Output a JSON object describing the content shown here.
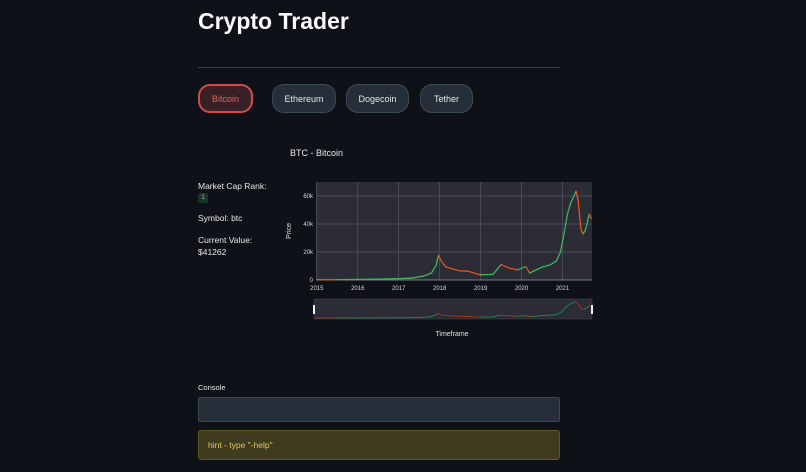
{
  "app": {
    "title": "Crypto Trader"
  },
  "coins": [
    {
      "label": "Bitcoin",
      "active": true
    },
    {
      "label": "Ethereum",
      "active": false
    },
    {
      "label": "Dogecoin",
      "active": false
    },
    {
      "label": "Tether",
      "active": false
    }
  ],
  "info": {
    "rank_label": "Market Cap Rank:",
    "rank_value": "1",
    "symbol": "Symbol: btc",
    "value_label": "Current Value:",
    "value": "$41262"
  },
  "chart_data": {
    "type": "line",
    "title": "BTC - Bitcoin",
    "xlabel": "Timeframe",
    "ylabel": "Price",
    "x_ticks": [
      "2015",
      "2016",
      "2017",
      "2018",
      "2019",
      "2020",
      "2021"
    ],
    "y_ticks": [
      "0",
      "20k",
      "40k",
      "60k"
    ],
    "ylim": [
      0,
      70000
    ],
    "xlim": [
      2014.98,
      2021.72
    ],
    "grid": true,
    "range_slider": true,
    "colors": {
      "up": "#3db65a",
      "down": "#e8501e"
    },
    "series": [
      {
        "x": [
          2015.0,
          2015.5,
          2016.0,
          2016.5,
          2017.0,
          2017.3,
          2017.6,
          2017.8,
          2017.92,
          2017.97,
          2018.05,
          2018.15,
          2018.3,
          2018.5,
          2018.7,
          2018.85,
          2019.0,
          2019.3,
          2019.5,
          2019.7,
          2019.9,
          2020.1,
          2020.2,
          2020.5,
          2020.7,
          2020.85,
          2020.95,
          2021.05,
          2021.12,
          2021.2,
          2021.28,
          2021.33,
          2021.38,
          2021.45,
          2021.5,
          2021.55,
          2021.6,
          2021.65,
          2021.7
        ],
        "y": [
          300,
          250,
          430,
          650,
          1000,
          1300,
          2800,
          5000,
          11000,
          17500,
          13000,
          9500,
          8000,
          6500,
          6300,
          4800,
          3700,
          4000,
          11000,
          8500,
          7200,
          9500,
          5000,
          9200,
          10800,
          13500,
          20000,
          35000,
          47000,
          55000,
          60000,
          63500,
          57000,
          36000,
          33000,
          35000,
          40000,
          47000,
          44000
        ]
      }
    ]
  },
  "console": {
    "label": "Console",
    "value": "",
    "placeholder": ""
  },
  "hint": {
    "text": "hint - type \"-help\""
  }
}
